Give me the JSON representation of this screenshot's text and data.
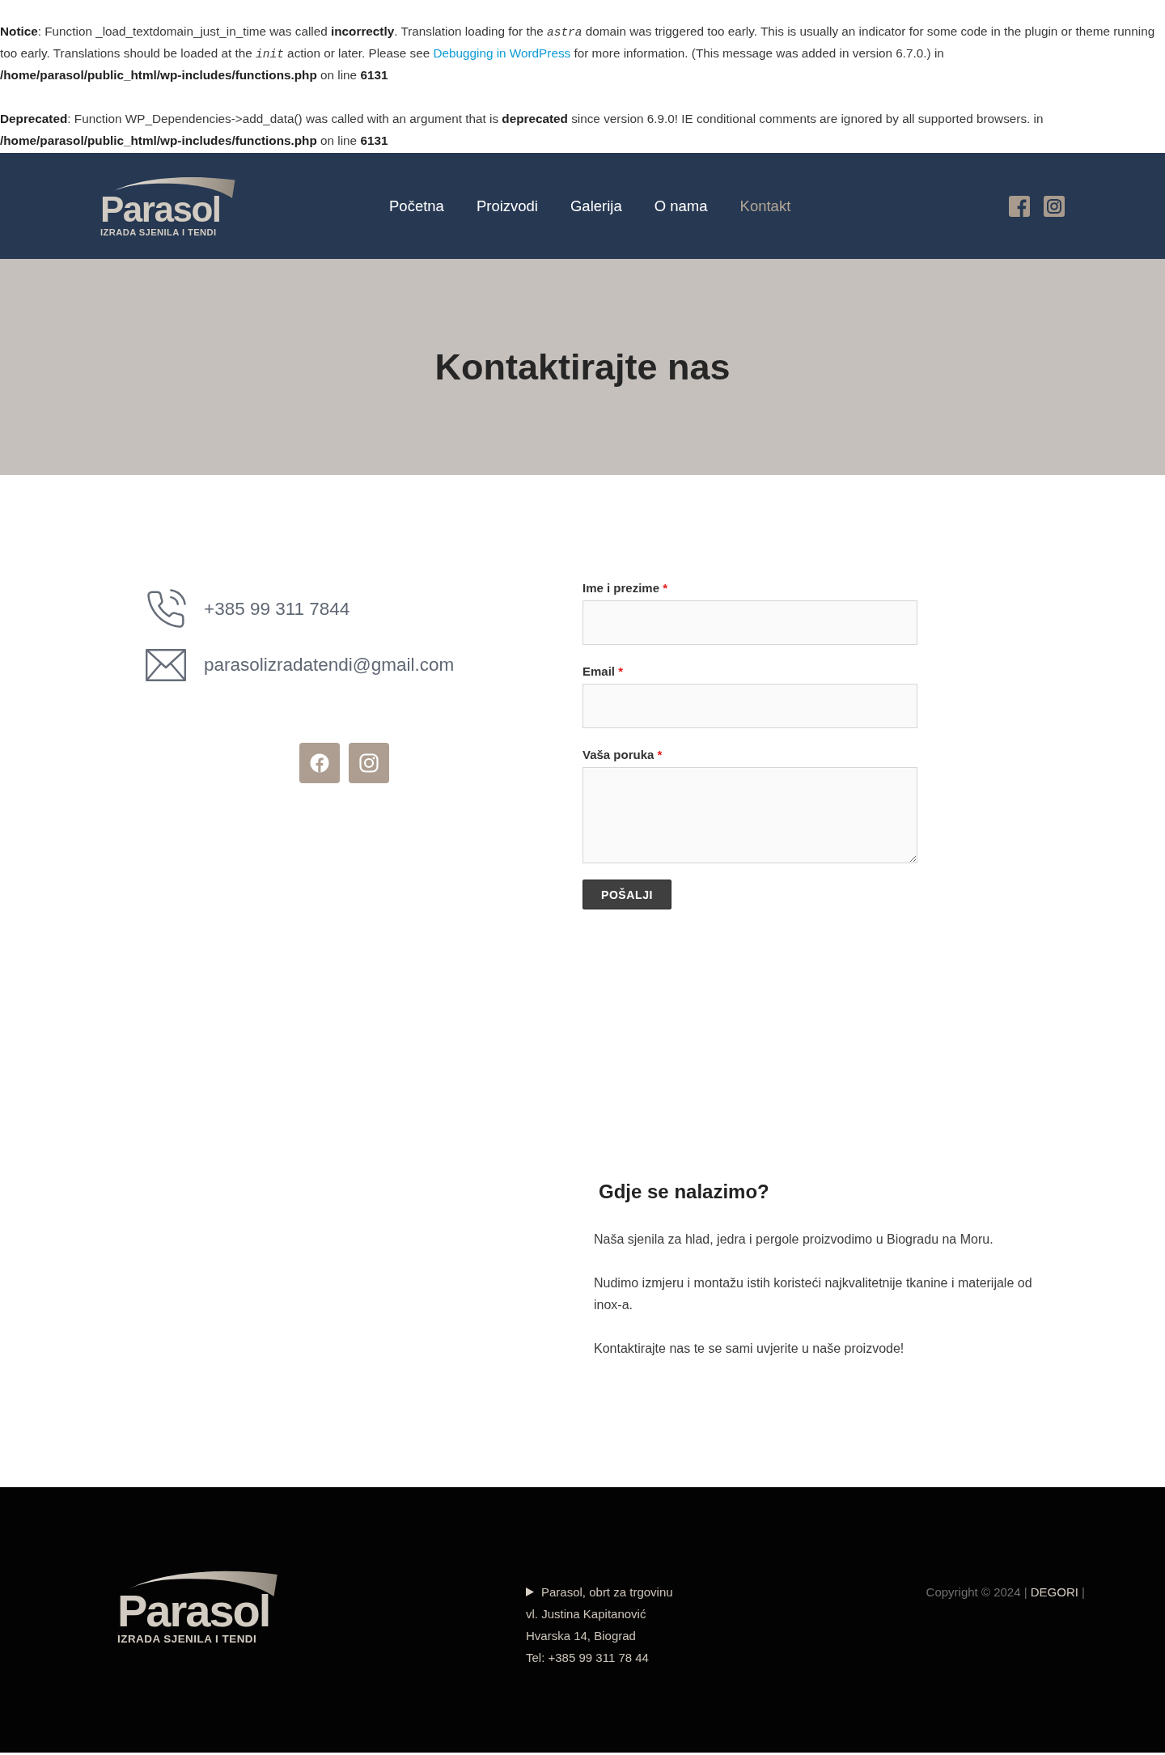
{
  "notices": [
    {
      "before": "**Notice**: Function _load_textdomain_just_in_time was called **incorrectly**. Translation loading for the *astra* domain was triggered too early. This is usually an indicator for some code in the plugin or theme running too early. Translations should be loaded at the *init* action or later. Please see",
      "link": "Debugging in WordPress",
      "after": "for more information. (This message was added in version 6.7.0.) in **/home/parasol/public_html/wp-includes/functions.php** on line **6131**"
    },
    {
      "before": "**Deprecated**: Function WP_Dependencies->add_data() was called with an argument that is **deprecated** since version 6.9.0! IE conditional comments are ignored by all supported browsers. in **/home/parasol/public_html/wp-includes/functions.php** on line **6131**"
    }
  ],
  "header": {
    "logo": {
      "name": "Parasol",
      "tagline": "IZRADA SJENILA I TENDI"
    },
    "nav": [
      {
        "label": "Početna",
        "selected": false
      },
      {
        "label": "Proizvodi",
        "selected": false
      },
      {
        "label": "Galerija",
        "selected": false
      },
      {
        "label": "O nama",
        "selected": false
      },
      {
        "label": "Kontakt",
        "selected": true
      }
    ]
  },
  "hero": {
    "title": "Kontaktirajte nas"
  },
  "contact": {
    "phone": "+385 99 311 7844",
    "email": "parasolizradatendi@gmail.com"
  },
  "form": {
    "fields": [
      {
        "kind": "text",
        "label": "Ime i prezime",
        "required_mark": "*"
      },
      {
        "kind": "email",
        "label": "Email",
        "required_mark": "*"
      },
      {
        "kind": "textarea",
        "label": "Vaša poruka",
        "required_mark": "*"
      }
    ],
    "submit": "POŠALJI"
  },
  "location": {
    "heading": "Gdje se nalazimo?",
    "paragraphs": [
      "Naša sjenila za hlad, jedra i pergole proizvodimo u Biogradu na Moru.",
      "Nudimo izmjeru i montažu istih koristeći najkvalitetnije tkanine i materijale od inox-a.",
      "Kontaktirajte nas te se sami uvjerite u naše proizvode!"
    ]
  },
  "footer": {
    "logo": {
      "name": "Parasol",
      "tagline": "IZRADA SJENILA I TENDI"
    },
    "address": [
      "Parasol, obrt za trgovinu",
      "vl. Justina Kapitanović",
      "Hvarska 14, Biograd",
      "Tel: +385 99 311 78 44"
    ],
    "copyright": {
      "before": "Copyright © 2024 |",
      "link": "DEGORI",
      "after": "|"
    }
  }
}
